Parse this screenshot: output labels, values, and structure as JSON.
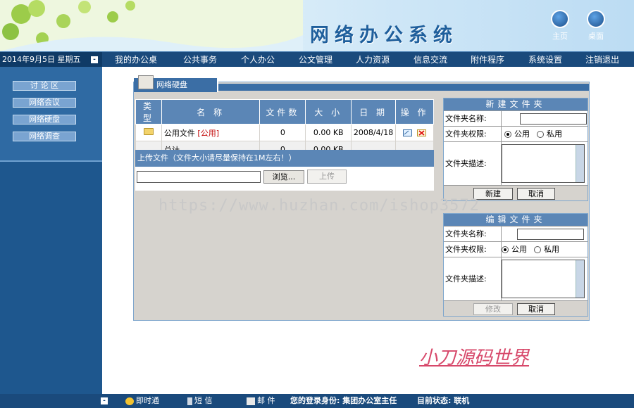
{
  "header": {
    "title": "网络办公系统",
    "buttons": [
      {
        "label": "主页",
        "icon": "home-icon"
      },
      {
        "label": "桌面",
        "icon": "desktop-icon"
      }
    ]
  },
  "navbar": {
    "date": "2014年9月5日 星期五",
    "collapse_glyph": "-",
    "items": [
      "我的办公桌",
      "公共事务",
      "个人办公",
      "公文管理",
      "人力资源",
      "信息交流",
      "附件程序",
      "系统设置",
      "注销退出"
    ]
  },
  "sidebar": {
    "items": [
      "讨 论 区",
      "网络会议",
      "网络硬盘",
      "网络调查"
    ]
  },
  "panel": {
    "tab_label": "网络硬盘",
    "table": {
      "headers": [
        "类 型",
        "名 称",
        "文件数",
        "大 小",
        "日 期",
        "操 作"
      ],
      "rows": [
        {
          "name": "公用文件",
          "tag": "[公用]",
          "count": "0",
          "size": "0.00 KB",
          "date": "2008/4/18"
        }
      ],
      "summary": {
        "label": "总计",
        "count": "0",
        "size": "0.00 KB"
      }
    },
    "upload": {
      "hint": "上传文件（文件大小请尽量保持在1M左右！）",
      "browse_label": "浏览...",
      "upload_label": "上传"
    }
  },
  "new_folder": {
    "title": "新建文件夹",
    "name_label": "文件夹名称:",
    "perm_label": "文件夹权限:",
    "desc_label": "文件夹描述:",
    "public": "公用",
    "private": "私用",
    "submit": "新建",
    "cancel": "取消"
  },
  "edit_folder": {
    "title": "编辑文件夹",
    "name_label": "文件夹名称:",
    "perm_label": "文件夹权限:",
    "desc_label": "文件夹描述:",
    "public": "公用",
    "private": "私用",
    "submit": "修改",
    "cancel": "取消"
  },
  "watermark": "https://www.huzhan.com/ishop3572",
  "signature": "小刀源码世界",
  "statusbar": {
    "instant": "即时通",
    "sms": "短 信",
    "mail": "邮 件",
    "identity": "您的登录身份: 集团办公室主任",
    "status": "目前状态:  联机"
  }
}
